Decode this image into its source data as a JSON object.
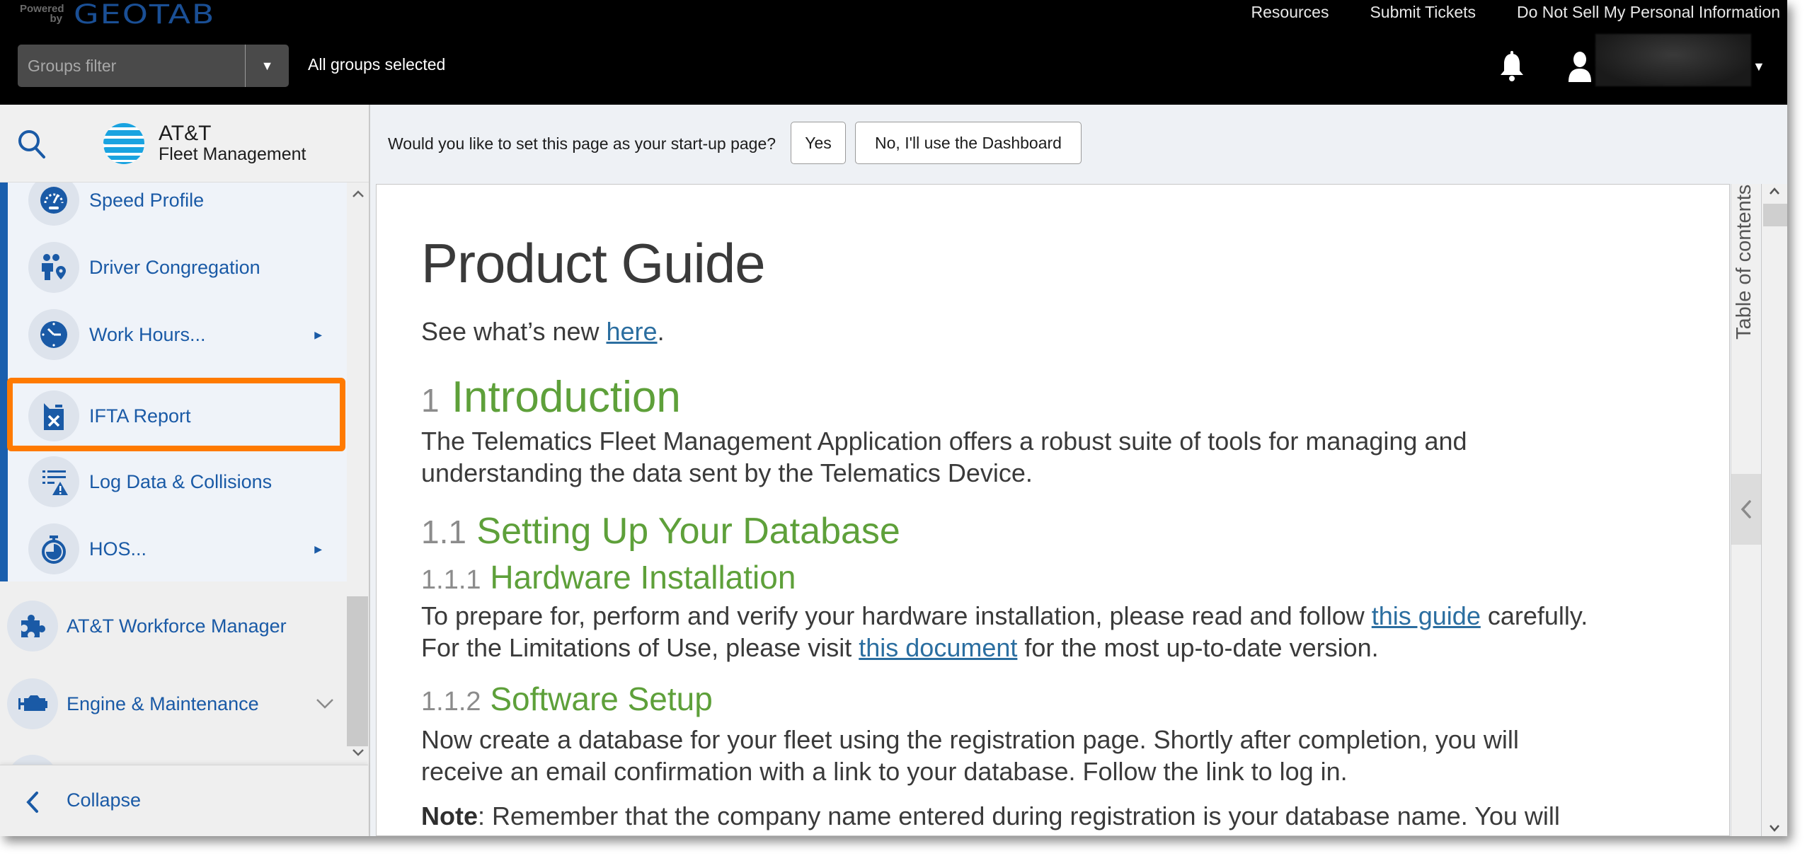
{
  "topbar": {
    "powered_by": "Powered by",
    "brand": "GEOTAB",
    "links": [
      "Resources",
      "Submit Tickets",
      "Do Not Sell My Personal Information"
    ],
    "groups_filter": {
      "placeholder": "Groups filter",
      "status": "All groups selected"
    },
    "icons": {
      "notifications": "bell-icon",
      "user": "user-icon",
      "user_menu": "caret-down-icon"
    }
  },
  "sidebar": {
    "logo": {
      "name": "AT&T",
      "subtitle": "Fleet Management"
    },
    "sub_items": [
      {
        "label": "Speed Profile",
        "icon": "speedometer-icon",
        "has_submenu": false
      },
      {
        "label": "Driver Congregation",
        "icon": "driver-congregation-icon",
        "has_submenu": false
      },
      {
        "label": "Work Hours...",
        "icon": "clock-icon",
        "has_submenu": true
      },
      {
        "label": "IFTA Report",
        "icon": "fuel-can-icon",
        "has_submenu": false,
        "highlighted": true
      },
      {
        "label": "Log Data & Collisions",
        "icon": "log-warning-icon",
        "has_submenu": false
      },
      {
        "label": "HOS...",
        "icon": "stopwatch-icon",
        "has_submenu": true
      }
    ],
    "top_items": [
      {
        "label": "AT&T Workforce Manager",
        "icon": "puzzle-icon",
        "expandable": false
      },
      {
        "label": "Engine & Maintenance",
        "icon": "engine-icon",
        "expandable": true
      }
    ],
    "collapse_label": "Collapse",
    "accent_color": "#1a5fae",
    "highlight_color": "#ff7a00"
  },
  "startup_prompt": {
    "question": "Would you like to set this page as your start-up page?",
    "yes_label": "Yes",
    "no_label": "No, I'll use the Dashboard"
  },
  "document": {
    "title": "Product Guide",
    "whats_new": {
      "before": "See what’s new ",
      "link": "here",
      "after": "."
    },
    "sections": {
      "intro": {
        "number": "1",
        "title": "Introduction",
        "lines": [
          "The Telematics Fleet Management Application offers a robust suite of tools for managing and",
          "understanding the data sent by the Telematics Device."
        ]
      },
      "database": {
        "number": "1.1",
        "title": "Setting Up Your Database"
      },
      "hardware": {
        "number": "1.1.1",
        "title": "Hardware Installation",
        "line1_before": "To prepare for, perform and verify your hardware installation, please read and follow ",
        "line1_link": "this guide",
        "line1_after": " carefully.",
        "line2_before": "For the Limitations of Use, please visit ",
        "line2_link": "this document",
        "line2_after": " for the most up-to-date version."
      },
      "software": {
        "number": "1.1.2",
        "title": "Software Setup",
        "lines": [
          "Now create a database for your fleet using the registration page. Shortly after completion, you will",
          "receive an email confirmation with a link to your database. Follow the link to log in."
        ],
        "note_label": "Note",
        "note_text": ": Remember that the company name entered during registration is your database name. You will"
      }
    },
    "heading_color": "#5ea03a",
    "link_color": "#2b6ea0"
  },
  "toc": {
    "label": "Table of contents"
  }
}
